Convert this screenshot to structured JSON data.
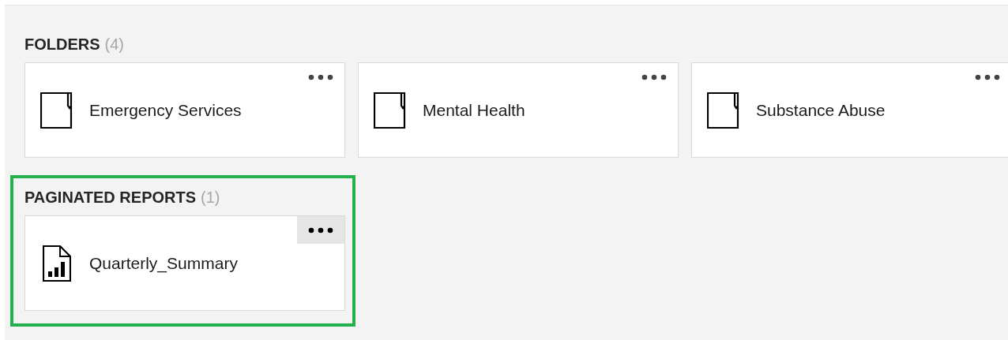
{
  "sections": [
    {
      "title": "FOLDERS",
      "count": "(4)",
      "highlighted": false,
      "items": [
        {
          "kind": "folder",
          "name": "Emergency Services",
          "menu_hovered": false
        },
        {
          "kind": "folder",
          "name": "Mental Health",
          "menu_hovered": false
        },
        {
          "kind": "folder",
          "name": "Substance Abuse",
          "menu_hovered": false
        }
      ]
    },
    {
      "title": "PAGINATED REPORTS",
      "count": "(1)",
      "highlighted": true,
      "items": [
        {
          "kind": "report",
          "name": "Quarterly_Summary",
          "menu_hovered": true
        }
      ]
    }
  ]
}
